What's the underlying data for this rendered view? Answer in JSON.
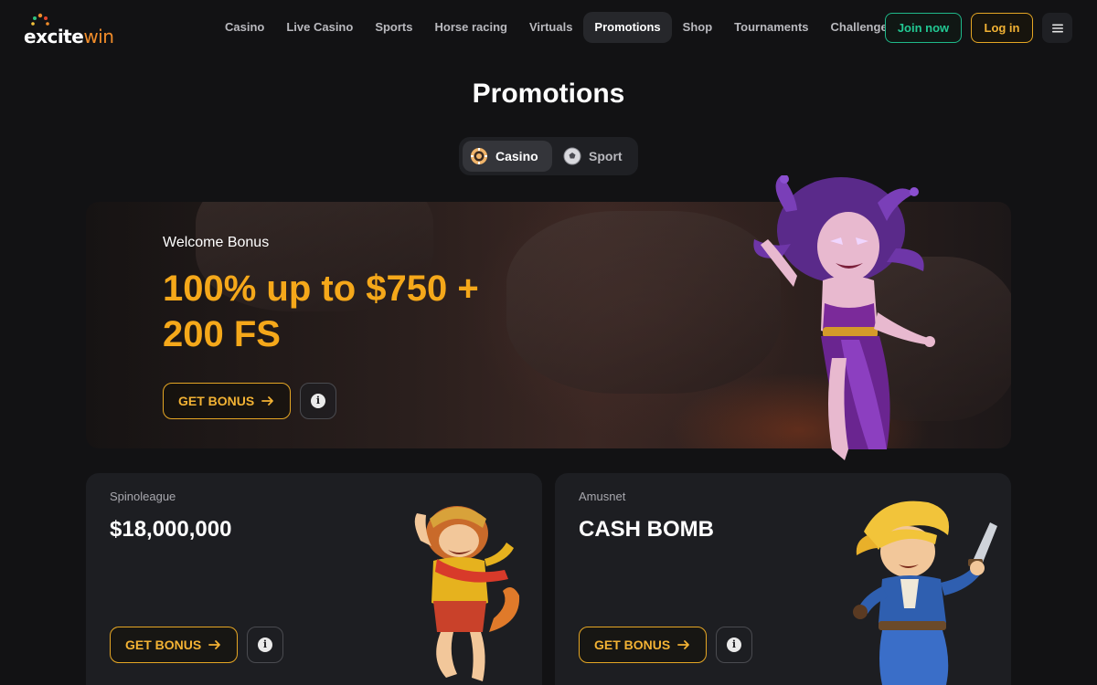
{
  "brand": {
    "logo_text_part1": "excite",
    "logo_text_part2": "win"
  },
  "nav": {
    "items": [
      {
        "label": "Casino"
      },
      {
        "label": "Live Casino"
      },
      {
        "label": "Sports"
      },
      {
        "label": "Horse racing"
      },
      {
        "label": "Virtuals"
      },
      {
        "label": "Promotions",
        "active": true
      },
      {
        "label": "Shop"
      },
      {
        "label": "Tournaments"
      },
      {
        "label": "Challenges"
      }
    ],
    "join_label": "Join now",
    "login_label": "Log in",
    "menu_icon": "hamburger-icon"
  },
  "page": {
    "title": "Promotions"
  },
  "switcher": {
    "tabs": [
      {
        "label": "Casino",
        "icon": "casino-chip-icon",
        "active": true
      },
      {
        "label": "Sport",
        "icon": "soccer-ball-icon",
        "active": false
      }
    ]
  },
  "hero": {
    "label": "Welcome Bonus",
    "title": "100% up to $750 + 200 FS",
    "cta_label": "GET BONUS",
    "info_symbol": "i"
  },
  "cards": [
    {
      "provider": "Spinoleague",
      "title": "$18,000,000",
      "cta_label": "GET BONUS",
      "info_symbol": "i"
    },
    {
      "provider": "Amusnet",
      "title": "CASH BOMB",
      "cta_label": "GET BONUS",
      "info_symbol": "i"
    }
  ],
  "colors": {
    "background": "#121214",
    "accent_gold": "#f2b234",
    "accent_green": "#22c893",
    "card_bg": "#1d1e22"
  }
}
